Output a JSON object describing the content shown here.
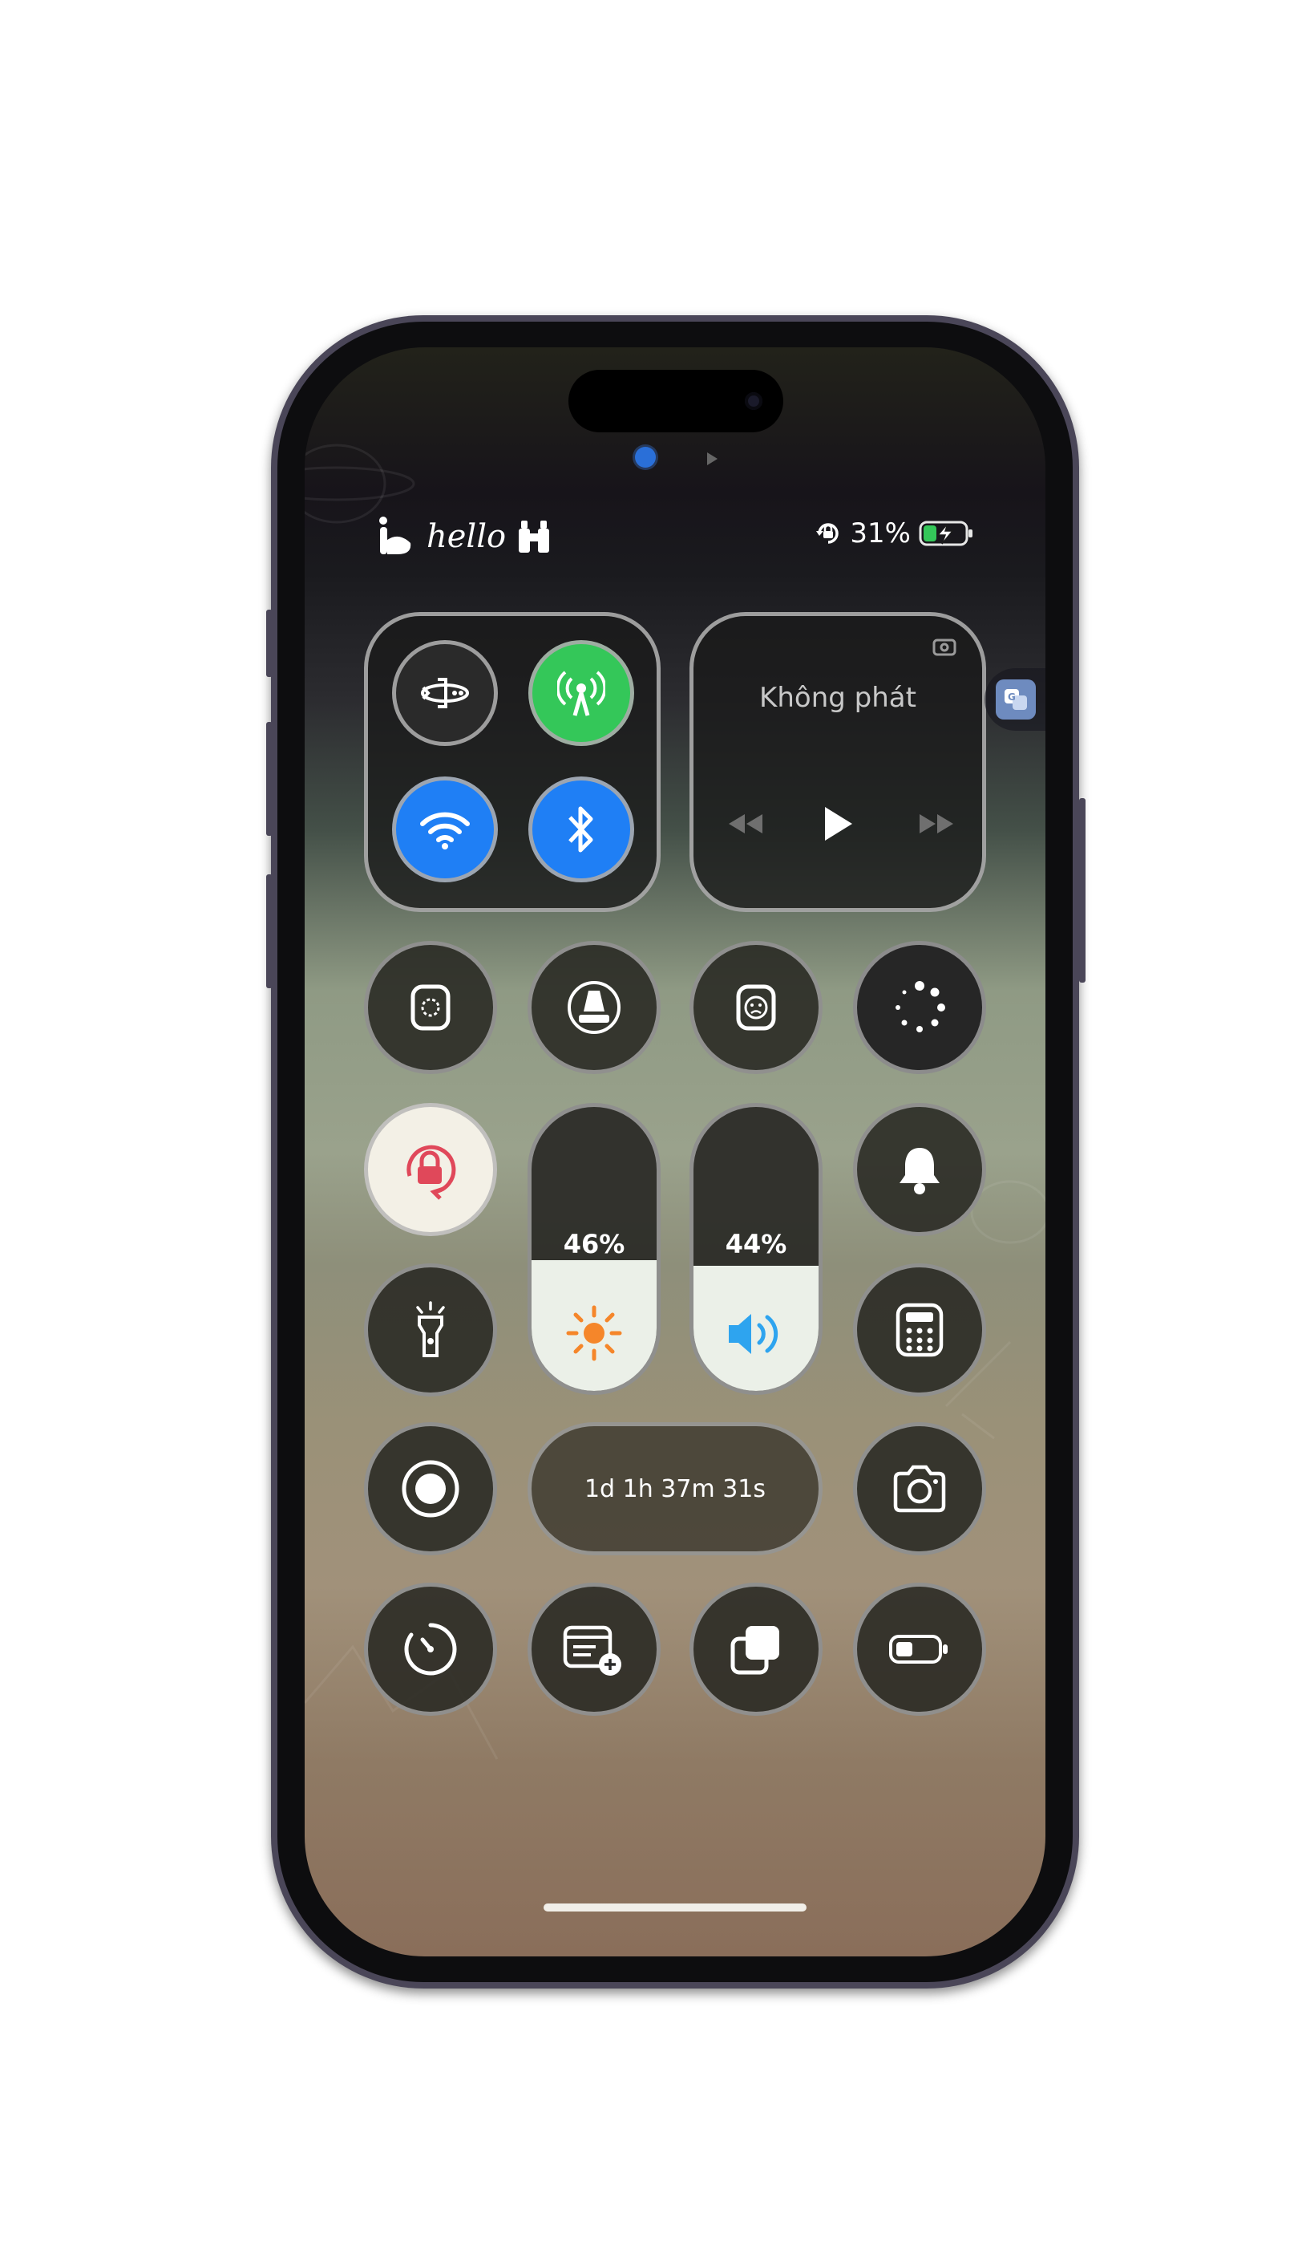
{
  "status_bar": {
    "greeting": "hello",
    "battery_percent": "31%"
  },
  "connectivity": {
    "airplane": false,
    "cellular": true,
    "wifi": true,
    "bluetooth": true
  },
  "media": {
    "now_playing": "Không phát"
  },
  "sliders": {
    "brightness": {
      "label": "46%",
      "level": 0.46
    },
    "volume": {
      "label": "44%",
      "level": 0.44
    }
  },
  "timer": {
    "text": "1d 1h 37m 31s"
  },
  "side_tab": {
    "icon": "translate-icon"
  },
  "colors": {
    "cellular_on": "#34c759",
    "wifi_on": "#1f7ff5",
    "rotation_lock": "#e0485a",
    "brightness_sun": "#f5862a",
    "volume_speaker": "#2ea4ef",
    "battery_charging": "#34c759"
  }
}
